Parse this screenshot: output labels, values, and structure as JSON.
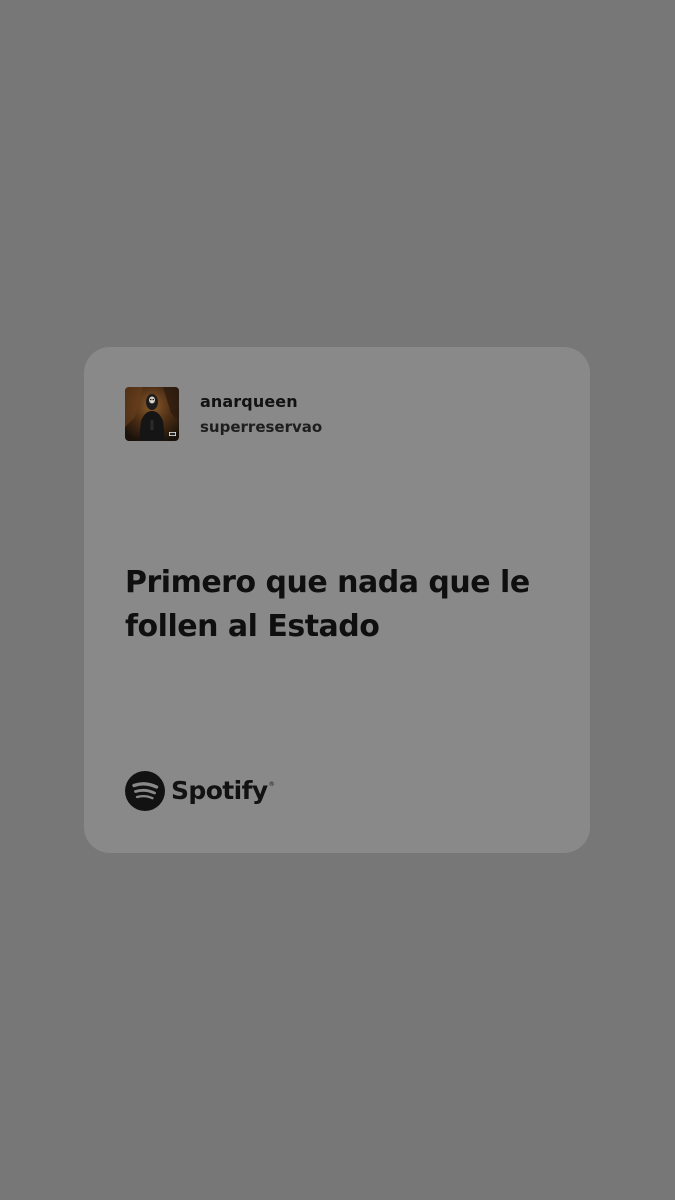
{
  "track": {
    "title": "anarqueen",
    "artist": "superreservao",
    "album_art_icon": "album-cover-image"
  },
  "lyric": {
    "text": "Primero que nada que le follen al Estado"
  },
  "brand": {
    "name": "Spotify",
    "registered_mark": "®",
    "icon": "spotify-logo-icon"
  },
  "colors": {
    "background": "#777777",
    "card": "#898989",
    "text": "#121212"
  }
}
